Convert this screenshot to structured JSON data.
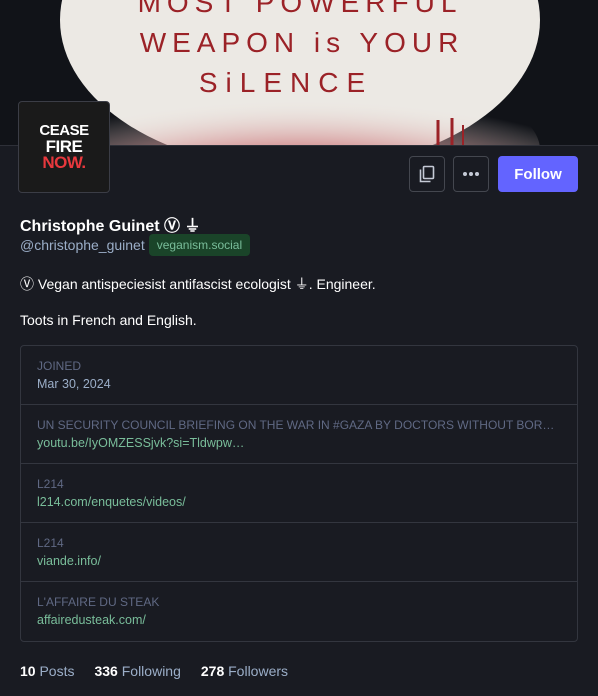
{
  "header": {
    "banner_text": [
      "MOST POWERFUL",
      "WEAPON is YOUR",
      "SiLENCE"
    ],
    "banner_colors": {
      "background": "#111318",
      "disc": "#ece9e4",
      "blood": "#b6343a",
      "ink": "#9b2227"
    }
  },
  "avatar": {
    "line1": "CEASE",
    "line2": "FIRE",
    "line3": "NOW."
  },
  "actions": {
    "copy_icon": "copy-icon",
    "more_icon": "more-horizontal-icon",
    "follow_label": "Follow"
  },
  "profile": {
    "display_name": "Christophe Guinet Ⓥ ⏚",
    "handle": "@christophe_guinet",
    "domain": "veganism.social",
    "bio_line1": "Ⓥ Vegan antispeciesist antifascist ecologist ⏚.   Engineer.",
    "bio_line2": "Toots in French and English."
  },
  "fields": [
    {
      "label": "JOINED",
      "value": "Mar 30, 2024"
    },
    {
      "label": "UN SECURITY COUNCIL BRIEFING ON THE WAR IN #GAZA BY DOCTORS WITHOUT BORDERS",
      "value": "youtu.be/IyOMZESSjvk?si=Tldwpw…"
    },
    {
      "label": "L214",
      "value": "l214.com/enquetes/videos/"
    },
    {
      "label": "L214",
      "value": "viande.info/"
    },
    {
      "label": "L'AFFAIRE DU STEAK",
      "value": "affairedusteak.com/"
    }
  ],
  "stats": {
    "posts_count": "10",
    "posts_label": "Posts",
    "following_count": "336",
    "following_label": "Following",
    "followers_count": "278",
    "followers_label": "Followers"
  },
  "colors": {
    "accent": "#6364ff",
    "link": "#79bd9a",
    "muted": "#9baec8",
    "background": "#191b22"
  }
}
